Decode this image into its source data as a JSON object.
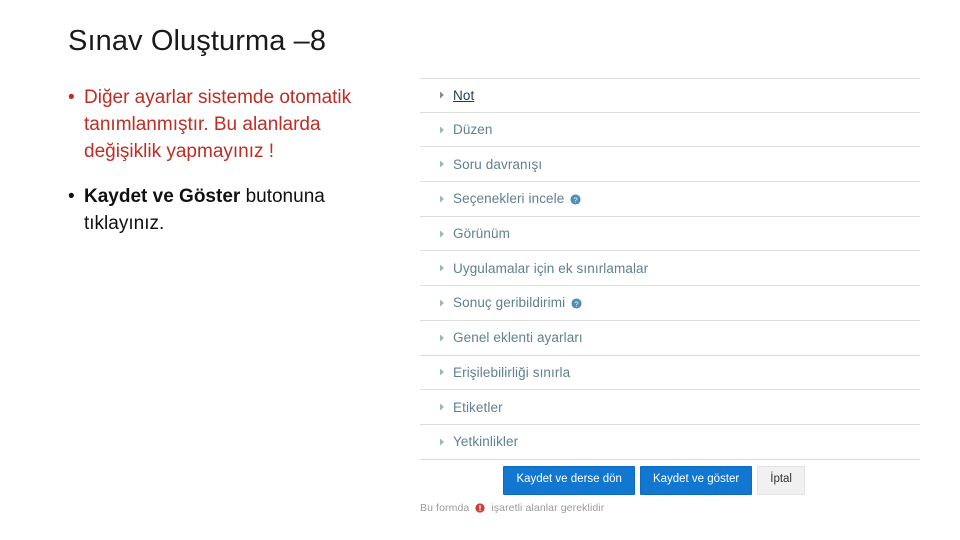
{
  "slide": {
    "title": "Sınav Oluşturma –8",
    "accent_red": "#be2d24",
    "link_teal": "#5e8191",
    "primary_blue": "#1177d1"
  },
  "bullets": [
    {
      "marker": "•",
      "text": "Diğer ayarlar sistemde otomatik tanımlanmıştır. Bu alanlarda değişiklik yapmayınız !",
      "color": "red"
    },
    {
      "marker": "•",
      "bold_text": "Kaydet ve Göster",
      "rest_text": " butonuna tıklayınız.",
      "color": "black"
    }
  ],
  "moodle_form": {
    "sections": [
      {
        "label": "Not",
        "icon": "triangle-right-icon",
        "active": true,
        "help": false
      },
      {
        "label": "Düzen",
        "icon": "triangle-right-icon",
        "active": false,
        "help": false
      },
      {
        "label": "Soru davranışı",
        "icon": "triangle-right-icon",
        "active": false,
        "help": false
      },
      {
        "label": "Seçenekleri incele",
        "icon": "triangle-right-icon",
        "active": false,
        "help": true
      },
      {
        "label": "Görünüm",
        "icon": "triangle-right-icon",
        "active": false,
        "help": false
      },
      {
        "label": "Uygulamalar için ek sınırlamalar",
        "icon": "triangle-right-icon",
        "active": false,
        "help": false
      },
      {
        "label": "Sonuç geribildirimi",
        "icon": "triangle-right-icon",
        "active": false,
        "help": true
      },
      {
        "label": "Genel eklenti ayarları",
        "icon": "triangle-right-icon",
        "active": false,
        "help": false
      },
      {
        "label": "Erişilebilirliği sınırla",
        "icon": "triangle-right-icon",
        "active": false,
        "help": false
      },
      {
        "label": "Etiketler",
        "icon": "triangle-right-icon",
        "active": false,
        "help": false
      },
      {
        "label": "Yetkinlikler",
        "icon": "triangle-right-icon",
        "active": false,
        "help": false
      }
    ],
    "buttons": {
      "save_return": "Kaydet ve derse dön",
      "save_display": "Kaydet ve göster",
      "cancel": "İptal"
    },
    "required_note": {
      "prefix": "Bu formda",
      "icon": "required-exclamation-icon",
      "suffix": "işaretli alanlar gereklidir"
    }
  }
}
